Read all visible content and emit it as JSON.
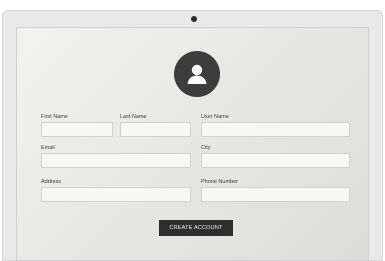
{
  "form": {
    "first_name": {
      "label": "First Name",
      "value": "",
      "placeholder": ""
    },
    "last_name": {
      "label": "Last Name",
      "value": "",
      "placeholder": ""
    },
    "user_name": {
      "label": "User Name",
      "value": "",
      "placeholder": ""
    },
    "email": {
      "label": "Email",
      "value": "",
      "placeholder": ""
    },
    "city": {
      "label": "City",
      "value": "",
      "placeholder": ""
    },
    "address": {
      "label": "Address",
      "value": "",
      "placeholder": ""
    },
    "phone_number": {
      "label": "Phone Number",
      "value": "",
      "placeholder": ""
    },
    "submit_label": "CREATE ACCOUNT"
  },
  "icons": {
    "avatar": "user-icon",
    "camera": "camera-icon"
  },
  "colors": {
    "avatar_bg": "#3d3d3d",
    "button_bg": "#2e2e2e",
    "screen_bg": "#e9e9e7"
  }
}
